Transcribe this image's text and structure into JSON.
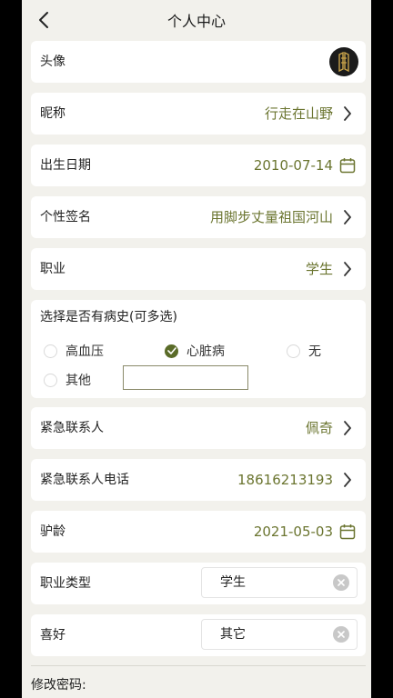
{
  "header": {
    "title": "个人中心"
  },
  "rows": {
    "avatar": {
      "label": "头像"
    },
    "nickname": {
      "label": "昵称",
      "value": "行走在山野"
    },
    "birthdate": {
      "label": "出生日期",
      "value": "2010-07-14"
    },
    "signature": {
      "label": "个性签名",
      "value": "用脚步丈量祖国河山"
    },
    "occupation": {
      "label": "职业",
      "value": "学生"
    },
    "emergency_contact": {
      "label": "紧急联系人",
      "value": "佩奇"
    },
    "emergency_phone": {
      "label": "紧急联系人电话",
      "value": "18616213193"
    },
    "riding_age": {
      "label": "驴龄",
      "value": "2021-05-03"
    },
    "occupation_type": {
      "label": "职业类型",
      "value": "学生"
    },
    "hobby": {
      "label": "喜好",
      "value": "其它"
    }
  },
  "medical_history": {
    "title": "选择是否有病史(可多选)",
    "options": [
      {
        "label": "高血压",
        "checked": false
      },
      {
        "label": "心脏病",
        "checked": true
      },
      {
        "label": "无",
        "checked": false
      },
      {
        "label": "其他",
        "checked": false
      }
    ],
    "other_value": ""
  },
  "password_section": {
    "label": "修改密码:"
  },
  "colors": {
    "accent": "#6b7530",
    "check": "#5a6b28",
    "background": "#f2f1ec"
  }
}
